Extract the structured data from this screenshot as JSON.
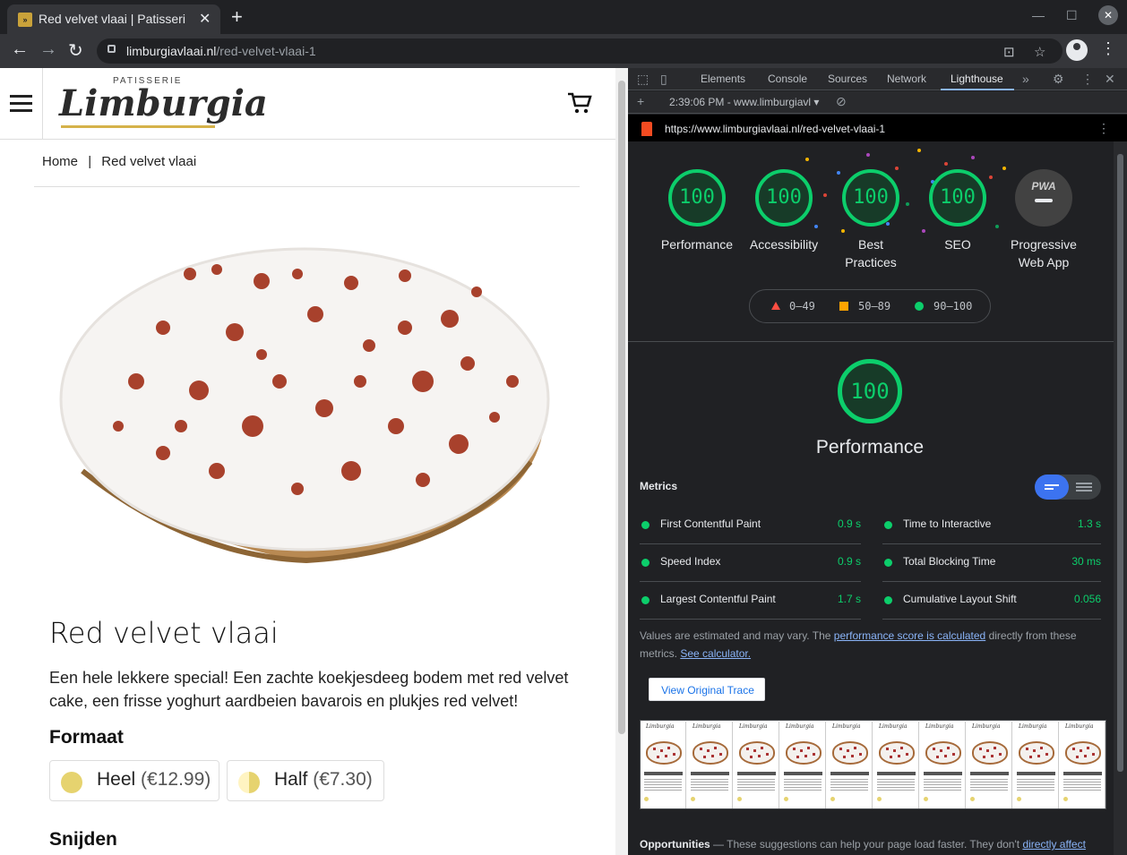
{
  "browser": {
    "tab_title": "Red velvet vlaai | Patisseri",
    "url_host": "limburgiavlaai.nl",
    "url_path": "/red-velvet-vlaai-1"
  },
  "site": {
    "logo_subtitle": "PATISSERIE",
    "logo": "Limburgia",
    "breadcrumb_home": "Home",
    "breadcrumb_sep": "|",
    "breadcrumb_current": "Red velvet vlaai",
    "product_title": "Red velvet vlaai",
    "product_description": "Een hele lekkere special! Een zachte koekjesdeeg bodem met red velvet cake, een frisse yoghurt aardbeien bavarois en plukjes red velvet!",
    "formaat_heading": "Formaat",
    "options": [
      {
        "name": "Heel",
        "price": "(€12.99)"
      },
      {
        "name": "Half",
        "price": "(€7.30)"
      }
    ],
    "snijden_heading": "Snijden"
  },
  "devtools": {
    "tabs": [
      "Elements",
      "Console",
      "Sources",
      "Network",
      "Lighthouse"
    ],
    "report_select": "2:39:06 PM - www.limburgiavl",
    "report_url": "https://www.limburgiavlaai.nl/red-velvet-vlaai-1",
    "categories": [
      {
        "score": "100",
        "label": "Performance"
      },
      {
        "score": "100",
        "label": "Accessibility"
      },
      {
        "score": "100",
        "label": "Best Practices"
      },
      {
        "score": "100",
        "label": "SEO"
      }
    ],
    "pwa": {
      "badge": "PWA",
      "label": "Progressive Web App"
    },
    "legend": [
      "0–49",
      "50–89",
      "90–100"
    ],
    "perf_score": "100",
    "perf_title": "Performance",
    "metrics_heading": "Metrics",
    "metrics": [
      {
        "name": "First Contentful Paint",
        "value": "0.9 s"
      },
      {
        "name": "Time to Interactive",
        "value": "1.3 s"
      },
      {
        "name": "Speed Index",
        "value": "0.9 s"
      },
      {
        "name": "Total Blocking Time",
        "value": "30 ms"
      },
      {
        "name": "Largest Contentful Paint",
        "value": "1.7 s"
      },
      {
        "name": "Cumulative Layout Shift",
        "value": "0.056"
      }
    ],
    "note_prefix": "Values are estimated and may vary. The",
    "note_link1": "performance score is calculated",
    "note_mid": "directly from these metrics.",
    "note_link2": "See calculator.",
    "view_trace": "View Original Trace",
    "opps_title": "Opportunities",
    "opps_text": "— These suggestions can help your page load faster. They don't",
    "opps_link": "directly affect"
  },
  "colors": {
    "pass": "#0cce6b",
    "average": "#ffa400",
    "fail": "#ff4e42",
    "link": "#8ab4f8"
  }
}
